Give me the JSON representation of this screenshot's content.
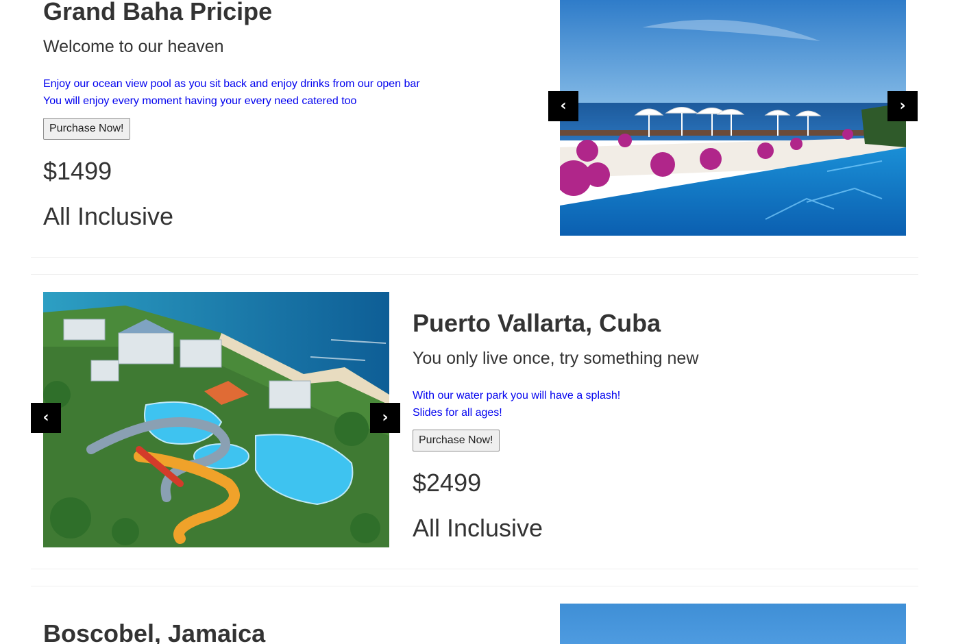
{
  "listings": [
    {
      "title": "Grand Baha Pricipe",
      "tagline": "Welcome to our heaven",
      "description": [
        "Enjoy our ocean view pool as you sit back and enjoy drinks from our open bar",
        "You will enjoy every moment having your every need catered too"
      ],
      "button_label": "Purchase Now!",
      "price": "$1499",
      "package": "All Inclusive",
      "image": "infinity-pool-ocean-view-photo"
    },
    {
      "title": "Puerto Vallarta, Cuba",
      "tagline": "You only live once, try something new",
      "description": [
        "With our water park you will have a splash!",
        "Slides for all ages!"
      ],
      "button_label": "Purchase Now!",
      "price": "$2499",
      "package": "All Inclusive",
      "image": "resort-water-park-aerial-photo"
    },
    {
      "title": "Boscobel, Jamaica",
      "image": "sky-photo"
    }
  ],
  "carousel": {
    "prev_glyph": "‹",
    "next_glyph": "›",
    "prev_icon": "chevron-left-icon",
    "next_icon": "chevron-right-icon"
  },
  "colors": {
    "link_blue": "#0000ee",
    "text": "#333333",
    "arrow_bg": "#000000",
    "divider": "#eeeeee"
  }
}
